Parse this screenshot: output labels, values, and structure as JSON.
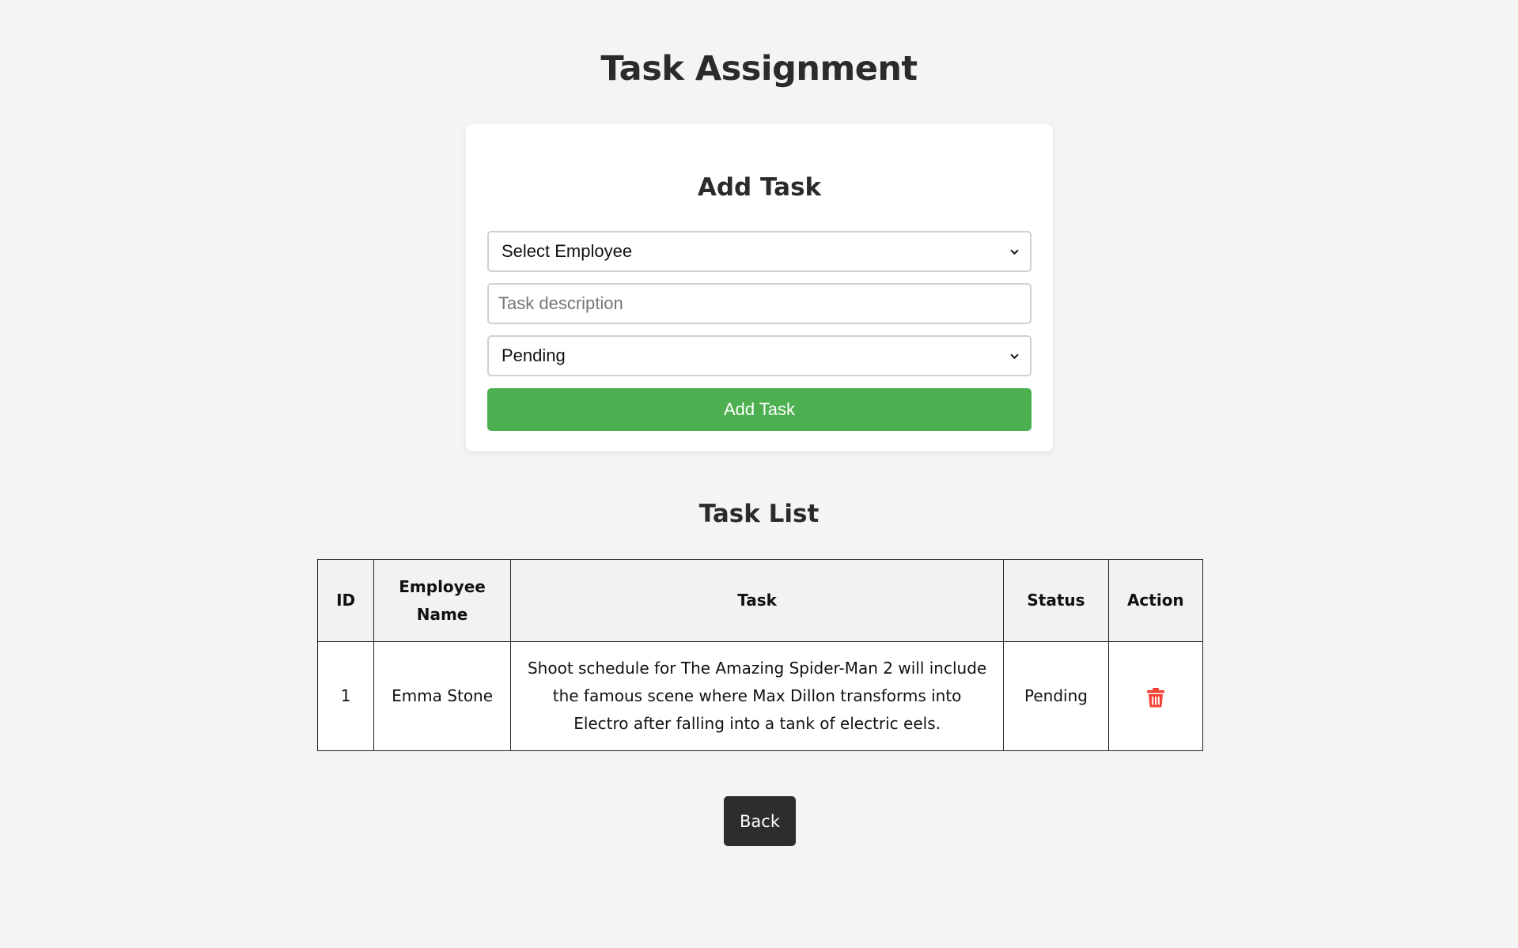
{
  "page": {
    "title": "Task Assignment"
  },
  "form": {
    "title": "Add Task",
    "employee_select": {
      "selected": "Select Employee"
    },
    "task_input": {
      "placeholder": "Task description",
      "value": ""
    },
    "status_select": {
      "selected": "Pending"
    },
    "submit_label": "Add Task"
  },
  "task_list": {
    "title": "Task List",
    "columns": [
      "ID",
      "Employee Name",
      "Task",
      "Status",
      "Action"
    ],
    "rows": [
      {
        "id": "1",
        "employee": "Emma Stone",
        "task": "Shoot schedule for The Amazing Spider-Man 2 will include the famous scene where Max Dillon transforms into Electro after falling into a tank of electric eels.",
        "status": "Pending",
        "action_icon": "trash-icon"
      }
    ]
  },
  "back_label": "Back",
  "colors": {
    "background": "#f4f4f4",
    "add_button": "#4caf50",
    "back_button": "#2d2d2d",
    "delete_icon": "#f44336"
  }
}
